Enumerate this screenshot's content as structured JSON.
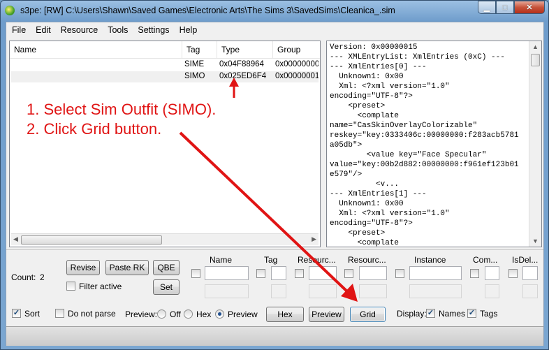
{
  "window": {
    "title": "s3pe: [RW] C:\\Users\\Shawn\\Saved Games\\Electronic Arts\\The Sims 3\\SavedSims\\Cleanica_.sim",
    "min_glyph": "▁",
    "max_glyph": "□",
    "close_glyph": "✕"
  },
  "menu": [
    "File",
    "Edit",
    "Resource",
    "Tools",
    "Settings",
    "Help"
  ],
  "list": {
    "columns": [
      "Name",
      "Tag",
      "Type",
      "Group"
    ],
    "rows": [
      {
        "name": "",
        "tag": "SIME",
        "type": "0x04F88964",
        "group": "0x00000000"
      },
      {
        "name": "",
        "tag": "SIMO",
        "type": "0x025ED6F4",
        "group": "0x00000001"
      }
    ]
  },
  "xml_text": "Version: 0x00000015\n--- XMLEntryList: XmlEntries (0xC) ---\n--- XmlEntries[0] ---\n  Unknown1: 0x00\n  Xml: <?xml version=\"1.0\"\nencoding=\"UTF-8\"?>\n    <preset>\n      <complate\nname=\"CasSkinOverlayColorizable\"\nreskey=\"key:0333406c:00000000:f283acb5781\na05db\">\n        <value key=\"Face Specular\"\nvalue=\"key:00b2d882:00000000:f961ef123b01\ne579\"/>\n          <v...\n--- XmlEntries[1] ---\n  Unknown1: 0x00\n  Xml: <?xml version=\"1.0\"\nencoding=\"UTF-8\"?>\n    <preset>\n      <complate",
  "bottom": {
    "count_label": "Count:",
    "count_value": "2",
    "revise": "Revise",
    "paste_rk": "Paste RK",
    "qbe": "QBE",
    "set": "Set",
    "filter_active": "Filter active",
    "filter_columns": [
      "Name",
      "Tag",
      "Resourc...",
      "Resourc...",
      "Instance",
      "Com...",
      "IsDel..."
    ],
    "sort": "Sort",
    "do_not_parse": "Do not parse",
    "preview_label": "Preview:",
    "off": "Off",
    "hex": "Hex",
    "preview": "Preview",
    "hex_button": "Hex",
    "preview_button": "Preview",
    "grid_button": "Grid",
    "display_label": "Display:",
    "names": "Names",
    "tags": "Tags"
  },
  "annotation": {
    "line1": "1. Select Sim Outfit (SIMO).",
    "line2": "2. Click Grid button.",
    "color": "#e01414"
  }
}
